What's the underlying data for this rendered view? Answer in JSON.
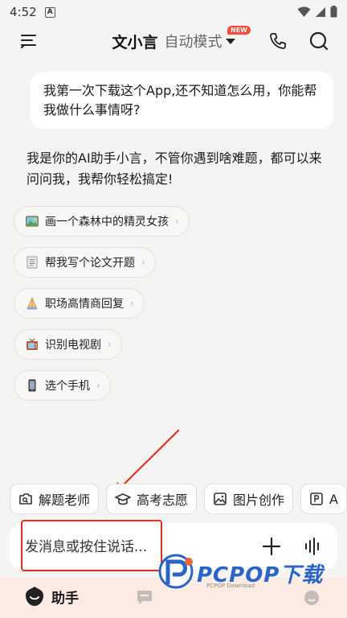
{
  "status_bar": {
    "time": "4:52",
    "a_icon_text": "A"
  },
  "header": {
    "title": "文小言",
    "mode": "自动模式",
    "badge": "NEW"
  },
  "chat": {
    "user_message": "我第一次下载这个App,还不知道怎么用，你能帮我做什么事情呀?",
    "ai_reply": "我是你的AI助手小言，不管你遇到啥难题，都可以来问问我，我帮你轻松搞定!"
  },
  "suggestions": [
    {
      "label": "画一个森林中的精灵女孩",
      "icon": "picture-icon"
    },
    {
      "label": "帮我写个论文开题",
      "icon": "document-icon"
    },
    {
      "label": "职场高情商回复",
      "icon": "pray-hands-icon"
    },
    {
      "label": "识别电视剧",
      "icon": "tv-icon"
    },
    {
      "label": "选个手机",
      "icon": "phone-device-icon"
    }
  ],
  "chips": [
    {
      "label": "解题老师",
      "icon": "camera-solve-icon"
    },
    {
      "label": "高考志愿",
      "icon": "graduation-cap-icon"
    },
    {
      "label": "图片创作",
      "icon": "image-create-icon"
    },
    {
      "label": "A",
      "icon": "ppt-icon"
    }
  ],
  "input": {
    "placeholder": "发消息或按住说话..."
  },
  "bottom_nav": {
    "assistant_label": "助手"
  },
  "watermark": {
    "text": "PCPOP下载",
    "sub": "PCPOP Download"
  },
  "colors": {
    "accent_red": "#e03020",
    "badge_red": "#ff4a3a",
    "bottom_bg": "#fbebe3"
  }
}
